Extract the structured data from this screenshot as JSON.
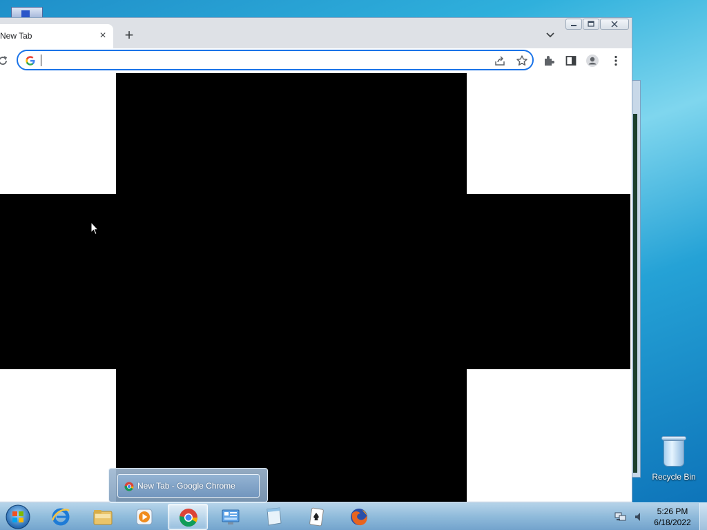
{
  "browser": {
    "tab_title": "New Tab",
    "tab_close": "×",
    "new_tab": "+",
    "address_value": "",
    "address_placeholder": ""
  },
  "taskbar": {
    "preview_title": "New Tab - Google Chrome",
    "clock_time": "5:26 PM",
    "clock_date": "6/18/2022",
    "pinned": [
      "internet-explorer",
      "windows-explorer",
      "media-player",
      "google-chrome",
      "control-panel",
      "notepad",
      "solitaire",
      "firefox"
    ],
    "active_app": "google-chrome"
  },
  "desktop": {
    "recycle_bin_label": "Recycle Bin"
  },
  "colors": {
    "accent": "#1a73e8",
    "tab_strip": "#dee1e6",
    "page_blocks": "#000000"
  }
}
